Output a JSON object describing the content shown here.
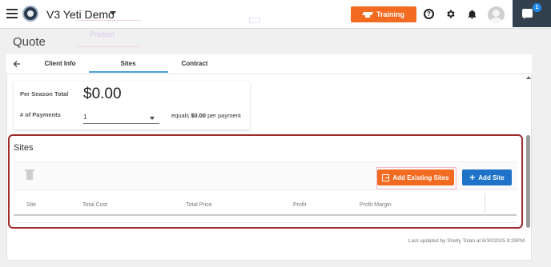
{
  "header": {
    "app_name": "V3 Yeti Demo",
    "training_label": "Training",
    "help_glyph": "?",
    "chat_badge_count": "1",
    "ghost_text": "Product"
  },
  "page": {
    "title": "Quote"
  },
  "tabs": [
    {
      "label": "Client Info",
      "active": false
    },
    {
      "label": "Sites",
      "active": true
    },
    {
      "label": "Contract",
      "active": false
    }
  ],
  "season": {
    "total_label": "Per Season Total",
    "total_value": "$0.00",
    "payments_label": "# of Payments",
    "payments_value": "1",
    "equals_prefix": "equals",
    "per_payment_amount": "$0.00",
    "equals_suffix": "per payment"
  },
  "sites": {
    "title": "Sites",
    "add_existing_label": "Add Existing Sites",
    "add_site_label": "Add Site",
    "columns": [
      "Site",
      "Total Cost",
      "Total Price",
      "Profit",
      "Profit Margin"
    ]
  },
  "footer": {
    "last_updated": "Last updated by Shelly Tolan at 6/30/2025 9:29PM"
  },
  "colors": {
    "accent_orange": "#f26b21",
    "primary_blue": "#1e73c8",
    "highlight_red": "#a12b2b",
    "nav_dark": "#33414f"
  },
  "icons": [
    "menu-icon",
    "logo-icon",
    "chevron-down-icon",
    "graduation-cap-icon",
    "help-icon",
    "gear-icon",
    "bell-icon",
    "avatar",
    "chat-icon",
    "back-arrow-icon",
    "trash-icon",
    "add-existing-icon",
    "plus-icon"
  ]
}
